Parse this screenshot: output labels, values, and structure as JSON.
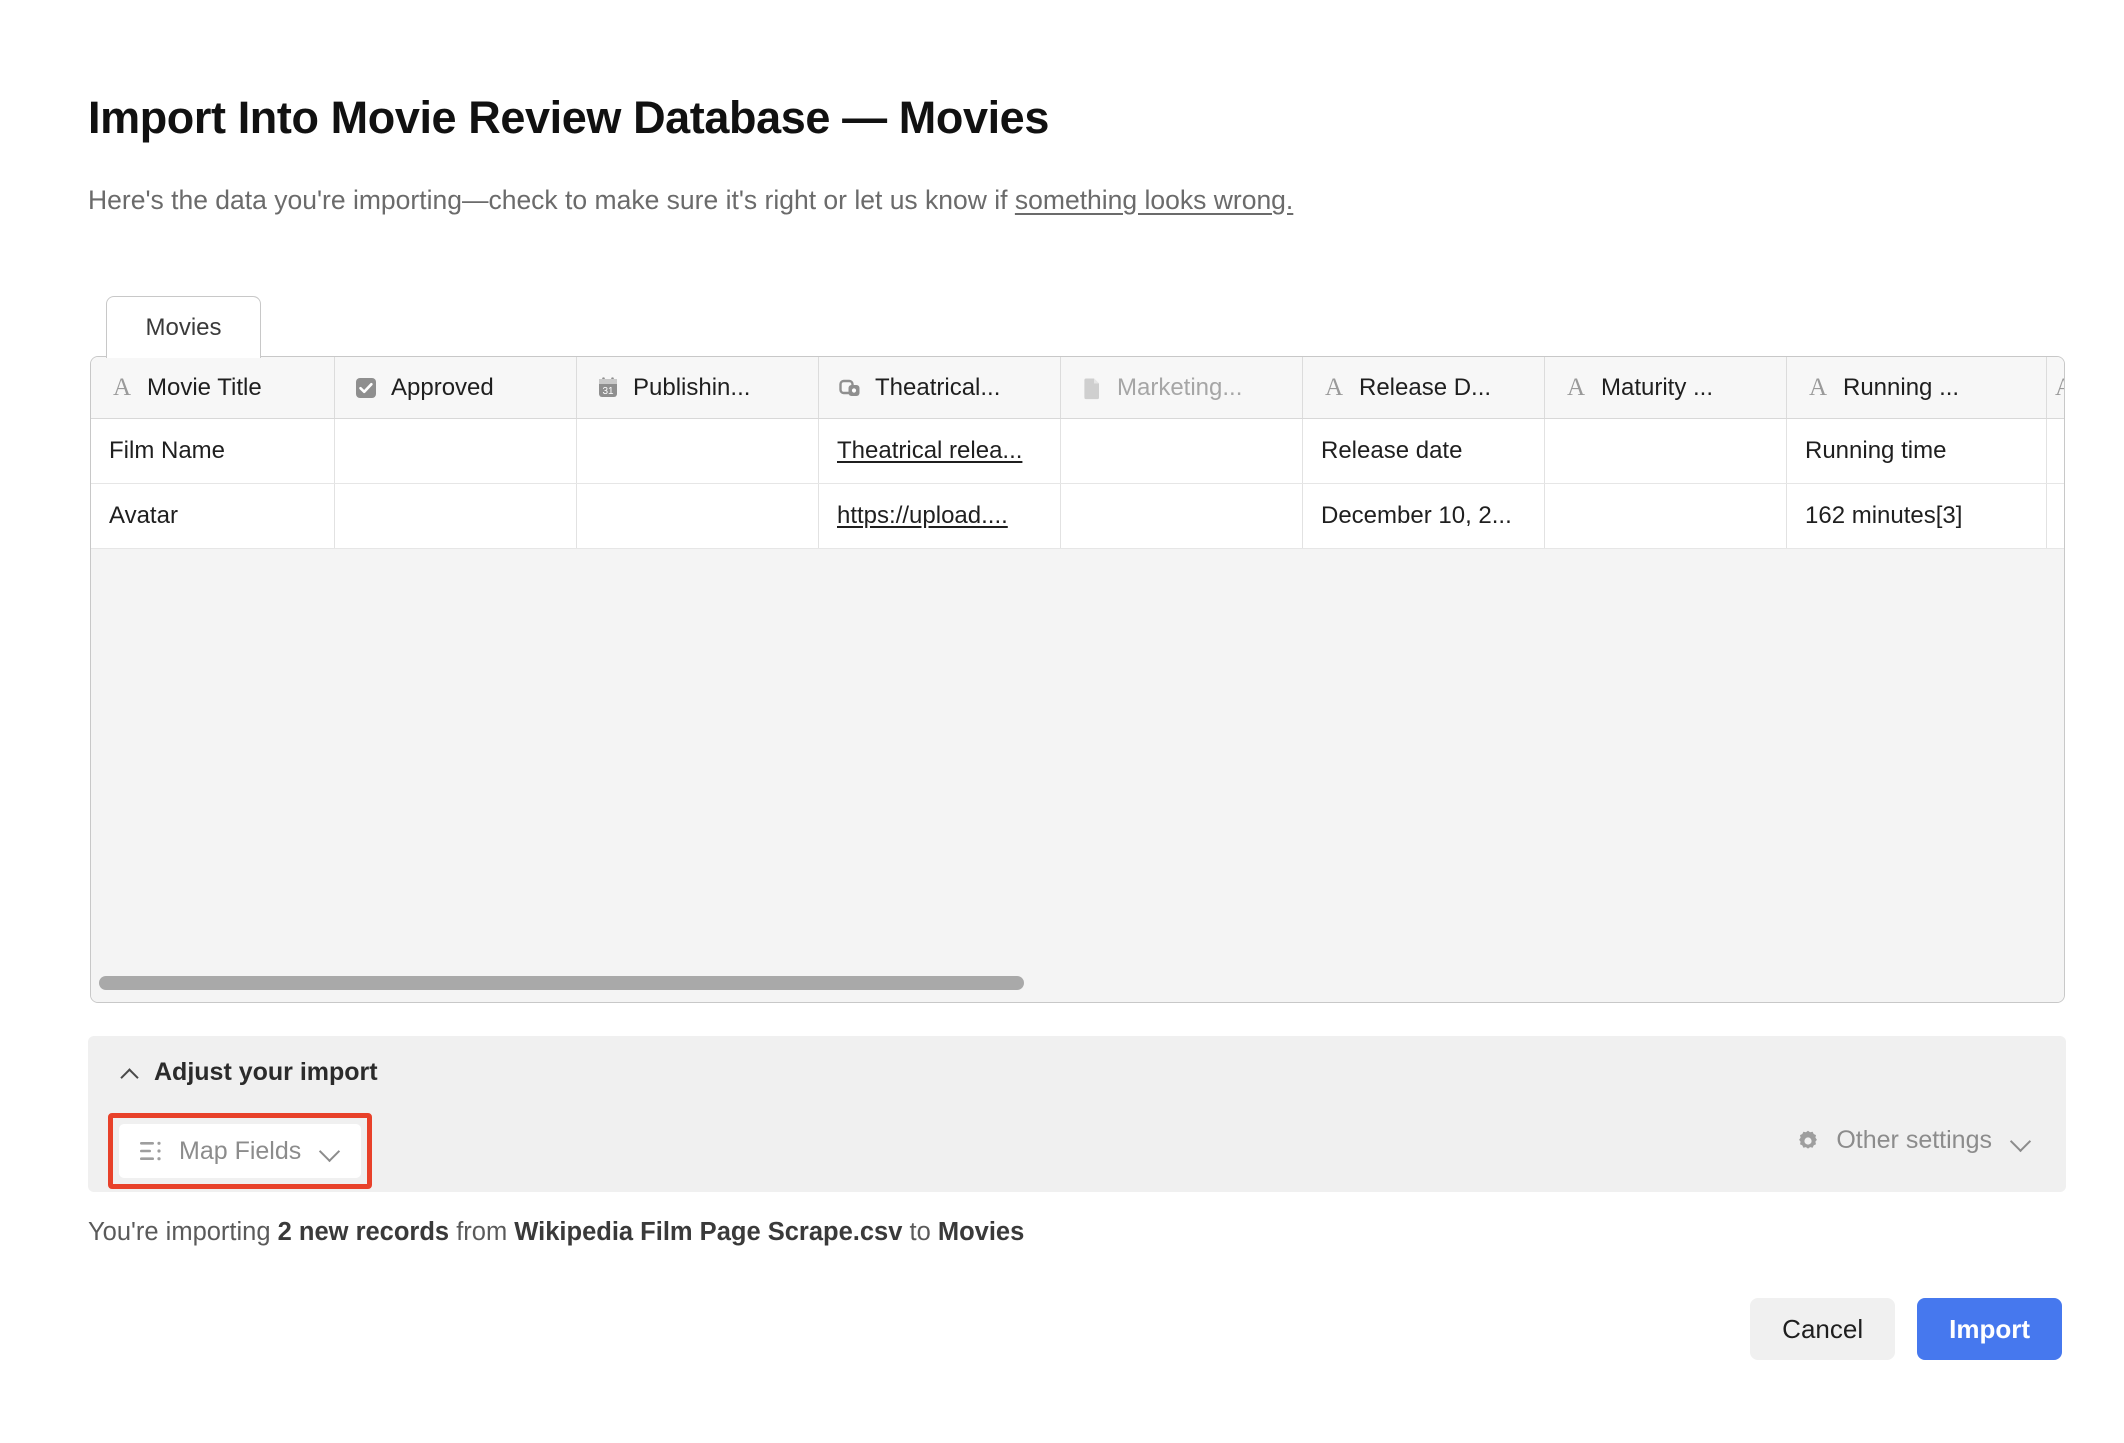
{
  "header": {
    "title": "Import Into Movie Review Database — Movies",
    "subtitle_before": "Here's the data you're importing—check to make sure it's right or let us know if ",
    "subtitle_link": "something looks wrong."
  },
  "tabs": [
    {
      "label": "Movies",
      "active": true
    }
  ],
  "table": {
    "columns": [
      {
        "label": "Movie Title",
        "icon": "text-field-icon",
        "muted": false
      },
      {
        "label": "Approved",
        "icon": "checkbox-field-icon",
        "muted": false
      },
      {
        "label": "Publishin...",
        "icon": "date-field-icon",
        "muted": false
      },
      {
        "label": "Theatrical...",
        "icon": "attachment-field-icon",
        "muted": false
      },
      {
        "label": "Marketing...",
        "icon": "document-field-icon",
        "muted": true
      },
      {
        "label": "Release D...",
        "icon": "text-field-icon",
        "muted": false
      },
      {
        "label": "Maturity ...",
        "icon": "text-field-icon",
        "muted": false
      },
      {
        "label": "Running ...",
        "icon": "text-field-icon",
        "muted": false
      }
    ],
    "rows": [
      {
        "movie_title": "Film Name",
        "approved": "",
        "publishing": "",
        "theatrical": "Theatrical relea...",
        "theatrical_is_link": true,
        "marketing": "",
        "release_date": "Release date",
        "maturity": "",
        "running_time": "Running time"
      },
      {
        "movie_title": "Avatar",
        "approved": "",
        "publishing": "",
        "theatrical": "https://upload....",
        "theatrical_is_link": true,
        "marketing": "",
        "release_date": "December 10, 2...",
        "maturity": "",
        "running_time": "162 minutes[3]"
      }
    ]
  },
  "adjust": {
    "toggle_label": "Adjust your import",
    "map_fields_label": "Map Fields",
    "other_settings_label": "Other settings",
    "highlight_color": "#e8412a"
  },
  "status": {
    "prefix": "You're importing ",
    "count": "2 new records",
    "middle": " from ",
    "source": "Wikipedia Film Page Scrape.csv",
    "suffix": " to ",
    "destination": "Movies"
  },
  "footer": {
    "cancel_label": "Cancel",
    "import_label": "Import",
    "import_color": "#4678ee"
  }
}
